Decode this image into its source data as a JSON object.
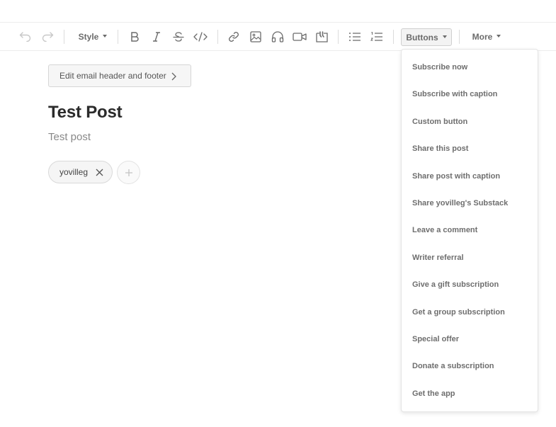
{
  "toolbar": {
    "style_label": "Style",
    "buttons_label": "Buttons",
    "more_label": "More",
    "icons": [
      "undo-icon",
      "redo-icon",
      "bold-icon",
      "italic-icon",
      "strikethrough-icon",
      "code-icon",
      "link-icon",
      "image-icon",
      "audio-icon",
      "video-icon",
      "quote-icon",
      "bullet-list-icon",
      "numbered-list-icon"
    ]
  },
  "editor": {
    "edit_header_label": "Edit email header and footer",
    "title": "Test Post",
    "subtitle": "Test post",
    "author": "yovilleg"
  },
  "buttons_menu": {
    "items": [
      "Subscribe now",
      "Subscribe with caption",
      "Custom button",
      "Share this post",
      "Share post with caption",
      "Share yovilleg's Substack",
      "Leave a comment",
      "Writer referral",
      "Give a gift subscription",
      "Get a group subscription",
      "Special offer",
      "Donate a subscription",
      "Get the app"
    ]
  },
  "colors": {
    "text_muted": "#6b6b6b",
    "icon_disabled": "#c8c8c8",
    "title": "#2b2b2b"
  }
}
